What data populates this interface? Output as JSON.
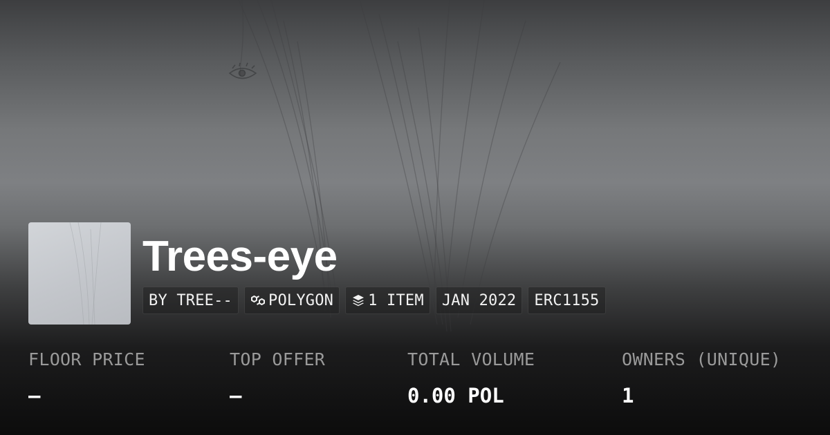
{
  "collection": {
    "title": "Trees-eye",
    "tags": [
      {
        "label": "BY TREE--",
        "icon": null
      },
      {
        "label": "POLYGON",
        "icon": "polygon-chain-icon"
      },
      {
        "label": "1 ITEM",
        "icon": "layers-icon"
      },
      {
        "label": "JAN 2022",
        "icon": null
      },
      {
        "label": "ERC1155",
        "icon": null
      }
    ]
  },
  "stats": [
    {
      "label": "FLOOR PRICE",
      "value": "—"
    },
    {
      "label": "TOP OFFER",
      "value": "—"
    },
    {
      "label": "TOTAL VOLUME",
      "value": "0.00 POL"
    },
    {
      "label": "OWNERS (UNIQUE)",
      "value": "1"
    }
  ],
  "colors": {
    "title": "#ffffff",
    "stat_label": "#9a9a9a",
    "stat_value": "#ffffff",
    "background_bottom": "#0c0c0c"
  }
}
